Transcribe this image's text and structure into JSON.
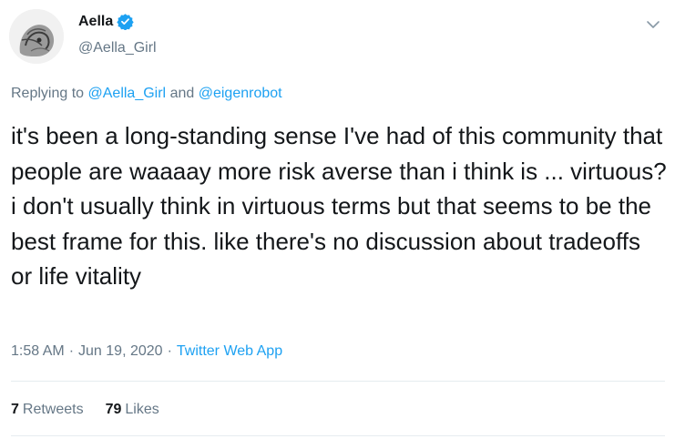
{
  "author": {
    "display_name": "Aella",
    "handle": "@Aella_Girl",
    "verified": true
  },
  "reply": {
    "prefix": "Replying to",
    "user1": "@Aella_Girl",
    "conj": "and",
    "user2": "@eigenrobot"
  },
  "tweet": {
    "text": "it's been a long-standing sense I've had of this community that people are waaaay more risk averse than i think is ... virtuous? i don't usually think in virtuous terms but that seems to be the best frame for this. like there's no discussion about tradeoffs or life vitality"
  },
  "meta": {
    "time": "1:58 AM",
    "separator": "·",
    "date": "Jun 19, 2020",
    "app": "Twitter Web App"
  },
  "stats": {
    "retweets_count": "7",
    "retweets_label": "Retweets",
    "likes_count": "79",
    "likes_label": "Likes"
  },
  "colors": {
    "accent": "#1da1f2",
    "secondary_text": "#657786",
    "divider": "#e6ecf0"
  },
  "icons": [
    "avatar-image",
    "verified-badge-icon",
    "chevron-down-icon"
  ]
}
